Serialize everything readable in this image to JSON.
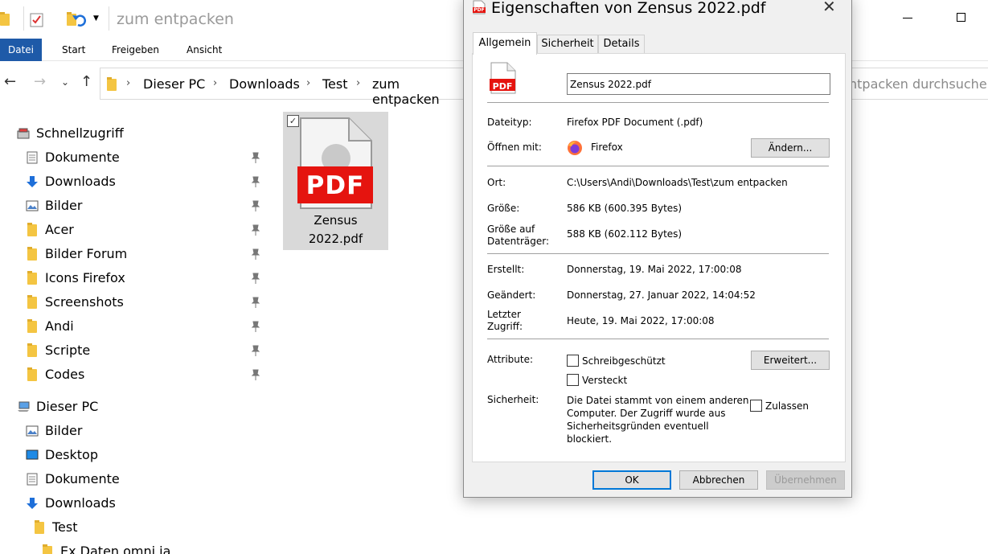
{
  "explorer": {
    "title": "zum entpacken",
    "ribbon_tabs": [
      "Datei",
      "Start",
      "Freigeben",
      "Ansicht"
    ],
    "breadcrumb": [
      "Dieser PC",
      "Downloads",
      "Test",
      "zum entpacken"
    ],
    "search_placeholder": "ntpacken durchsuchen",
    "sidebar": {
      "quick_access_label": "Schnellzugriff",
      "quick_items": [
        "Dokumente",
        "Downloads",
        "Bilder",
        "Acer",
        "Bilder Forum",
        "Icons Firefox",
        "Screenshots",
        "Andi",
        "Scripte",
        "Codes"
      ],
      "this_pc_label": "Dieser PC",
      "pc_items": [
        "Bilder",
        "Desktop",
        "Dokumente",
        "Downloads",
        "Test",
        "Ex Daten omni ia"
      ]
    },
    "file": {
      "icon_text": "PDF",
      "name_line1": "Zensus",
      "name_line2": "2022.pdf",
      "checked_mark": "✓"
    }
  },
  "dialog": {
    "title": "Eigenschaften von Zensus 2022.pdf",
    "close_glyph": "✕",
    "tabs": [
      "Allgemein",
      "Sicherheit",
      "Details"
    ],
    "file_icon_text": "PDF",
    "filename": "Zensus 2022.pdf",
    "filetype_label": "Dateityp:",
    "filetype_value": "Firefox PDF Document (.pdf)",
    "openwith_label": "Öffnen mit:",
    "openwith_value": "Firefox",
    "change_button": "Ändern...",
    "location_label": "Ort:",
    "location_value": "C:\\Users\\Andi\\Downloads\\Test\\zum entpacken",
    "size_label": "Größe:",
    "size_value": "586 KB (600.395 Bytes)",
    "sizeondisk_label_1": "Größe auf",
    "sizeondisk_label_2": "Datenträger:",
    "sizeondisk_value": "588 KB (602.112 Bytes)",
    "created_label": "Erstellt:",
    "created_value": "Donnerstag, 19. Mai 2022, 17:00:08",
    "modified_label": "Geändert:",
    "modified_value": "Donnerstag, 27. Januar 2022, 14:04:52",
    "accessed_label_1": "Letzter",
    "accessed_label_2": "Zugriff:",
    "accessed_value": "Heute, 19. Mai 2022, 17:00:08",
    "attributes_label": "Attribute:",
    "readonly_label": "Schreibgeschützt",
    "hidden_label": "Versteckt",
    "advanced_button": "Erweitert...",
    "security_label": "Sicherheit:",
    "security_text_1": "Die Datei stammt von einem anderen",
    "security_text_2": "Computer. Der Zugriff wurde aus",
    "security_text_3": "Sicherheitsgründen eventuell",
    "security_text_4": "blockiert.",
    "unblock_label": "Zulassen",
    "ok_button": "OK",
    "cancel_button": "Abbrechen",
    "apply_button": "Übernehmen"
  },
  "colors": {
    "pdf_red": "#e5140f",
    "ribbon_active": "#1e5aa8",
    "file_selected": "#d9d9d9"
  }
}
